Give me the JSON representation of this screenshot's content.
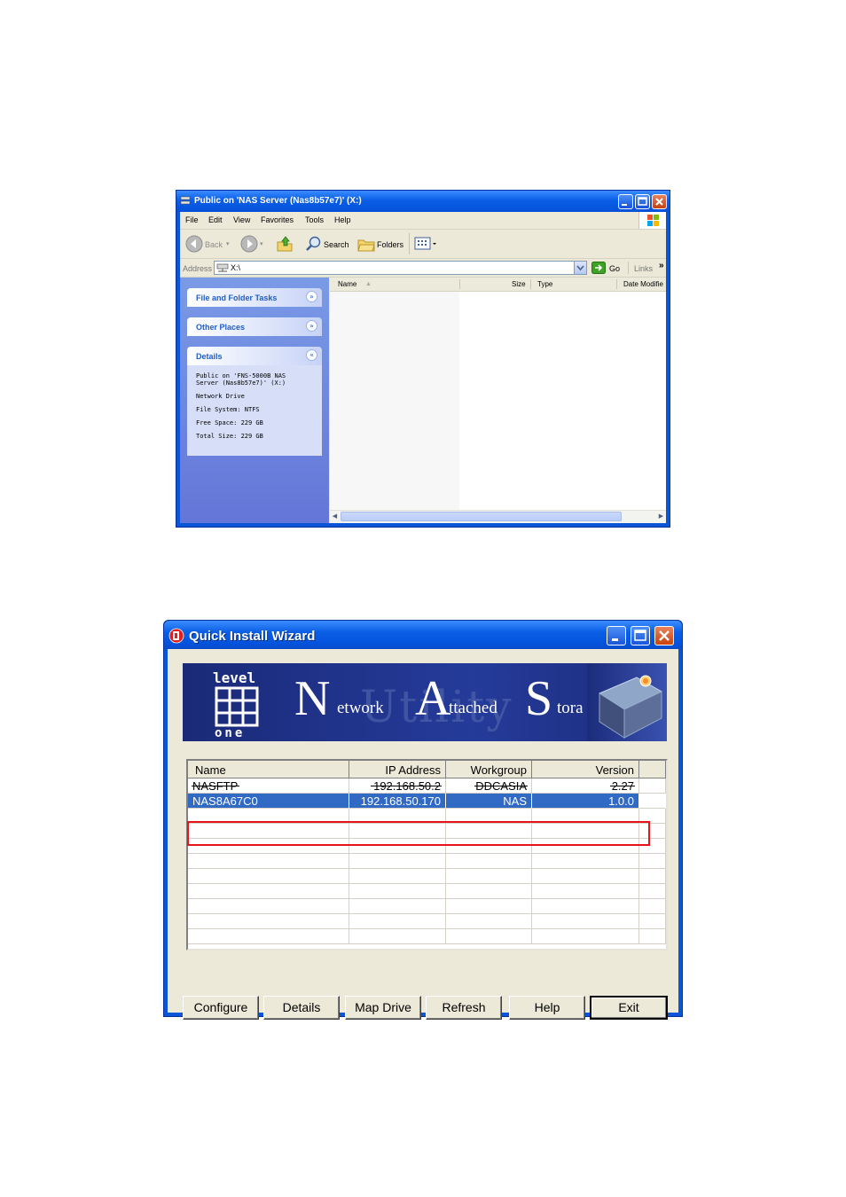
{
  "explorer": {
    "title": "Public on 'NAS Server (Nas8b57e7)' (X:)",
    "menu": [
      "File",
      "Edit",
      "View",
      "Favorites",
      "Tools",
      "Help"
    ],
    "toolbar": {
      "back": "Back",
      "search": "Search",
      "folders": "Folders"
    },
    "address": {
      "label": "Address",
      "value": "X:\\",
      "go": "Go",
      "links": "Links",
      "more": "»"
    },
    "tasks": {
      "file_folder": "File and Folder Tasks",
      "other_places": "Other Places",
      "details": "Details",
      "details_lines": [
        "Public on 'FNS-5000B NAS Server (Nas8b57e7)' (X:)",
        "Network Drive",
        "File System: NTFS",
        "Free Space: 229 GB",
        "Total Size: 229 GB"
      ]
    },
    "columns": {
      "name": "Name",
      "size": "Size",
      "type": "Type",
      "date": "Date Modifie"
    },
    "icons": [
      "folder-network-icon",
      "back-arrow-icon",
      "forward-arrow-icon",
      "up-folder-icon",
      "search-icon",
      "folders-icon",
      "views-icon",
      "network-drive-icon",
      "go-arrow-icon",
      "windows-logo-icon"
    ]
  },
  "wizard": {
    "title": "Quick Install Wizard",
    "banner": {
      "logo_top": "level",
      "logo_bottom": "one",
      "n": "N",
      "etwork": "etwork",
      "a": "A",
      "ttached": "ttached",
      "s": "S",
      "tora": "tora",
      "ghost": "Utility"
    },
    "columns": [
      "Name",
      "IP Address",
      "Workgroup",
      "Version"
    ],
    "rows": [
      [
        "NASFTP",
        "192.168.50.2",
        "DDCASIA",
        "2.27"
      ],
      [
        "NAS8A67C0",
        "192.168.50.170",
        "NAS",
        "1.0.0"
      ]
    ],
    "selected_row": 1,
    "buttons": [
      "Configure",
      "Details",
      "Map Drive",
      "Refresh",
      "Help",
      "Exit"
    ],
    "highlight_color": "#e8141a",
    "selection_color": "#316ac5"
  }
}
